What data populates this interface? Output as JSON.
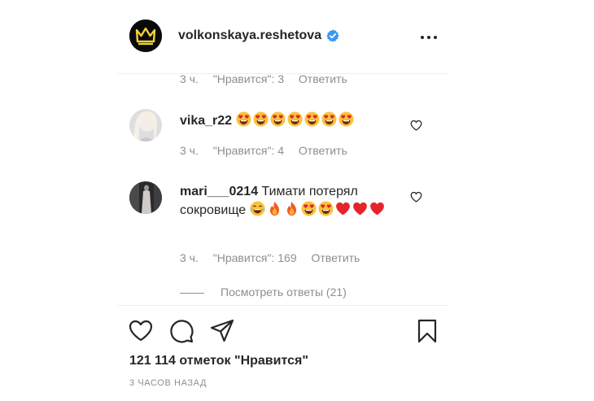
{
  "post": {
    "author": "volkonskaya.reshetova",
    "verified": true,
    "likes_text": "121 114 отметок \"Нравится\"",
    "time_ago": "3 ЧАСОВ НАЗАД"
  },
  "comments": [
    {
      "username": "",
      "text": "",
      "time": "3 ч.",
      "likes": "\"Нравится\": 3",
      "reply": "Ответить"
    },
    {
      "username": "vika_r22",
      "text": "",
      "emojis": [
        "heart-eyes",
        "heart-eyes",
        "heart-eyes",
        "heart-eyes",
        "heart-eyes",
        "heart-eyes",
        "heart-eyes"
      ],
      "time": "3 ч.",
      "likes": "\"Нравится\": 4",
      "reply": "Ответить"
    },
    {
      "username": "mari___0214",
      "text": "Тимати потерял сокровище",
      "emojis": [
        "joy",
        "fire",
        "fire",
        "heart-eyes",
        "heart-eyes",
        "red-heart",
        "red-heart",
        "red-heart"
      ],
      "time": "3 ч.",
      "likes": "\"Нравится\": 169",
      "reply": "Ответить"
    }
  ],
  "view_replies": "Посмотреть ответы (21)",
  "colors": {
    "text": "#262626",
    "muted": "#8e8e8e",
    "verified": "#3897f0",
    "border": "#efefef"
  },
  "icons": [
    "crown-logo",
    "verified-badge",
    "more-icon",
    "heart-icon",
    "comment-icon",
    "share-icon",
    "bookmark-icon"
  ]
}
